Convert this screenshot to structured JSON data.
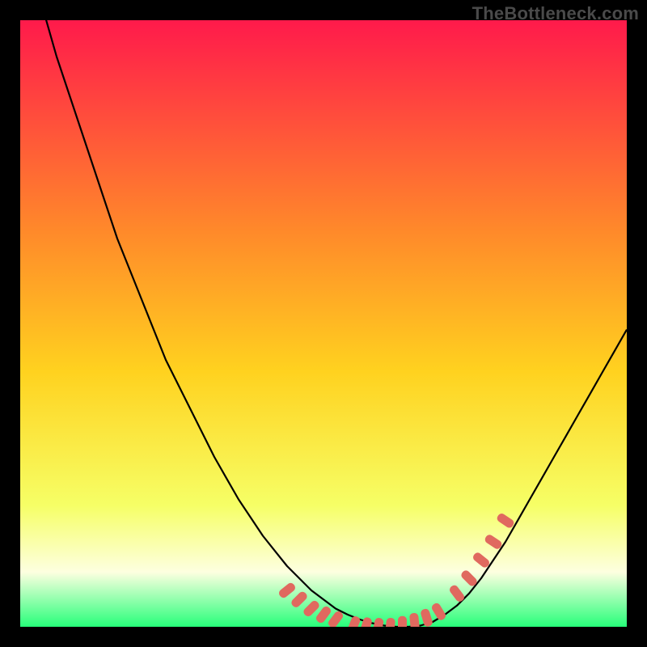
{
  "watermark": "TheBottleneck.com",
  "colors": {
    "frame_background": "#000000",
    "gradient_top": "#ff1a4b",
    "gradient_mid_upper": "#ff8a2a",
    "gradient_mid": "#ffd21f",
    "gradient_lower": "#f6ff66",
    "gradient_band_pale": "#fdffe0",
    "gradient_bottom": "#27ff7a",
    "curve_stroke": "#000000",
    "marker_fill": "#e0695f",
    "watermark_color": "#4a4a4a"
  },
  "chart_data": {
    "type": "line",
    "title": "",
    "xlabel": "",
    "ylabel": "",
    "xlim": [
      0,
      100
    ],
    "ylim": [
      0,
      100
    ],
    "grid": false,
    "legend": false,
    "x": [
      0,
      2,
      4,
      6,
      8,
      10,
      12,
      14,
      16,
      18,
      20,
      22,
      24,
      26,
      28,
      30,
      32,
      34,
      36,
      38,
      40,
      42,
      44,
      46,
      48,
      50,
      52,
      54,
      56,
      58,
      60,
      62,
      64,
      66,
      68,
      70,
      72,
      74,
      76,
      78,
      80,
      82,
      84,
      86,
      88,
      90,
      92,
      94,
      96,
      98,
      100
    ],
    "values": [
      115,
      108,
      101,
      94,
      88,
      82,
      76,
      70,
      64,
      59,
      54,
      49,
      44,
      40,
      36,
      32,
      28,
      24.5,
      21,
      18,
      15,
      12.5,
      10,
      8,
      6,
      4.5,
      3,
      2,
      1.2,
      0.6,
      0.2,
      0,
      0,
      0.2,
      0.8,
      2,
      3.5,
      5.5,
      8,
      11,
      14,
      17.5,
      21,
      24.5,
      28,
      31.5,
      35,
      38.5,
      42,
      45.5,
      49
    ],
    "markers": {
      "segments": [
        {
          "x_start": 44,
          "x_end": 52,
          "note": "left descending run into valley"
        },
        {
          "x_start": 54,
          "x_end": 70,
          "note": "valley floor to start of ascent"
        },
        {
          "x_start": 72,
          "x_end": 80,
          "note": "right ascending run"
        }
      ],
      "points": [
        {
          "x": 44,
          "y": 6
        },
        {
          "x": 46,
          "y": 4.5
        },
        {
          "x": 48,
          "y": 3
        },
        {
          "x": 50,
          "y": 2
        },
        {
          "x": 52,
          "y": 1.2
        },
        {
          "x": 55,
          "y": 0.3
        },
        {
          "x": 57,
          "y": 0.1
        },
        {
          "x": 59,
          "y": 0
        },
        {
          "x": 61,
          "y": 0
        },
        {
          "x": 63,
          "y": 0.3
        },
        {
          "x": 65,
          "y": 0.8
        },
        {
          "x": 67,
          "y": 1.5
        },
        {
          "x": 69,
          "y": 2.5
        },
        {
          "x": 72,
          "y": 5.5
        },
        {
          "x": 74,
          "y": 8
        },
        {
          "x": 76,
          "y": 11
        },
        {
          "x": 78,
          "y": 14
        },
        {
          "x": 80,
          "y": 17.5
        }
      ]
    }
  }
}
